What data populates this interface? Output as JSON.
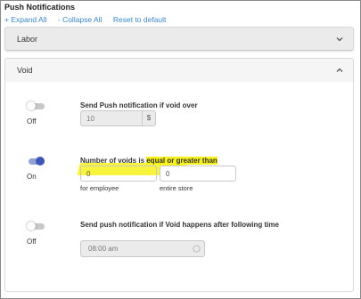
{
  "page": {
    "title": "Push Notifications"
  },
  "toolbar": {
    "expand_all": "+ Expand All",
    "collapse_all": "- Collapse All",
    "reset": "Reset to default"
  },
  "sections": {
    "labor": {
      "label": "Labor",
      "state": "collapsed",
      "icon": "chevron-down-icon"
    },
    "void": {
      "label": "Void",
      "state": "expanded",
      "icon": "chevron-up-icon"
    }
  },
  "void_rules": {
    "rule1": {
      "toggle_state": "Off",
      "title": "Send Push notification if void over",
      "value": "10",
      "addon": "$"
    },
    "rule2": {
      "toggle_state": "On",
      "title_plain": "Number of voids is ",
      "title_highlight": "equal or greater than",
      "employee_value": "0",
      "store_value": "0",
      "employee_label": "for employee",
      "store_label": "entire store"
    },
    "rule3": {
      "toggle_state": "Off",
      "title": "Send push notification if Void happens after following time",
      "time_value": "08:00 am",
      "icon": "clock-icon"
    }
  },
  "colors": {
    "accent_link": "#3a86c8",
    "toggle_on": "#3f56b5",
    "highlight": "#f7f21c"
  }
}
